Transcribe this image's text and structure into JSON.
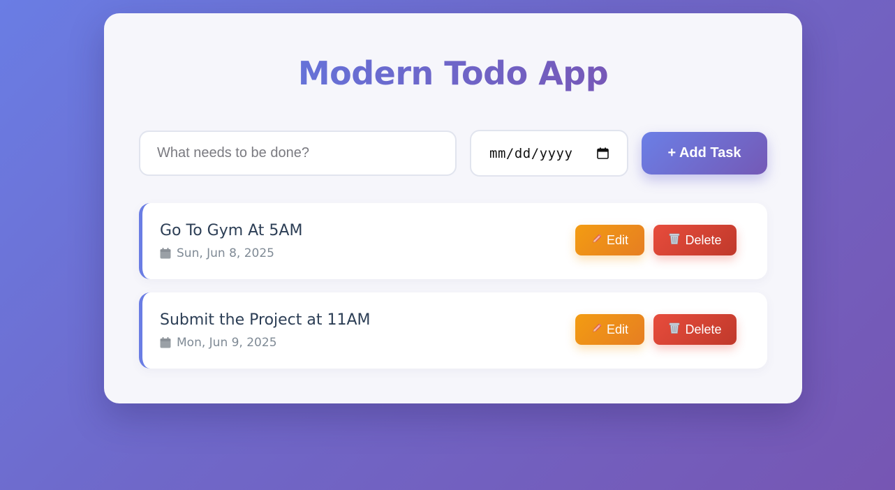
{
  "app": {
    "title": "Modern Todo App"
  },
  "form": {
    "task_placeholder": "What needs to be done?",
    "task_value": "",
    "date_placeholder": "mm/dd/yyyy",
    "add_button_label": "+ Add Task"
  },
  "tasks": [
    {
      "title": "Go To Gym At 5AM",
      "date": "Sun, Jun 8, 2025",
      "edit_label": "Edit",
      "delete_label": "Delete"
    },
    {
      "title": "Submit the Project at 11AM",
      "date": "Mon, Jun 9, 2025",
      "edit_label": "Edit",
      "delete_label": "Delete"
    }
  ],
  "icons": {
    "date_icon": "calendar-icon",
    "edit_icon": "pencil-icon",
    "delete_icon": "wastebasket-icon"
  },
  "colors": {
    "accent": "#6a7de4",
    "edit": "#f39c12",
    "delete": "#e74c3c",
    "title_text": "#2c3e55"
  }
}
